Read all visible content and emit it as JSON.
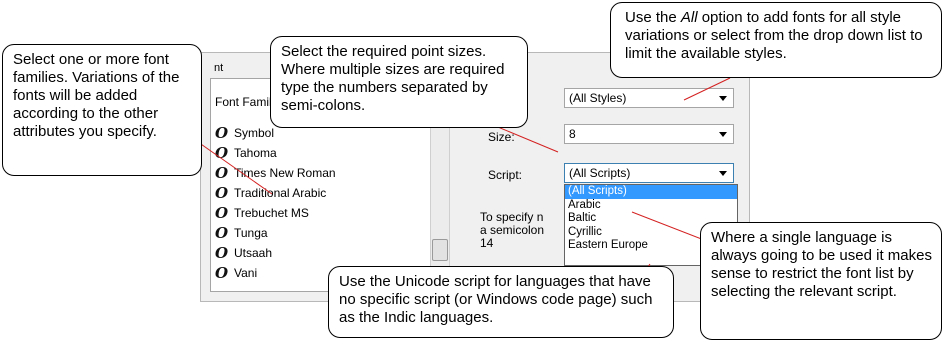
{
  "dialog": {
    "group_label": "nt",
    "list_header": "Font Famil",
    "fonts": [
      "Symbol",
      "Tahoma",
      "Times New Roman",
      "Traditional Arabic",
      "Trebuchet MS",
      "Tunga",
      "Utsaah",
      "Vani"
    ]
  },
  "style": {
    "value": "(All Styles)"
  },
  "size": {
    "label": "Size:",
    "value": "8"
  },
  "script": {
    "label": "Script:",
    "value": "(All Scripts)",
    "options": [
      "(All Scripts)",
      "Arabic",
      "Baltic",
      "Cyrillic",
      "Eastern Europe"
    ]
  },
  "hint": {
    "line1": "To specify n",
    "line2": "a semicolon",
    "line3": "14"
  },
  "callouts": {
    "families": "Select one or more font families. Variations of the fonts will be added according to the other attributes you specify.",
    "sizes": "Select the required point sizes. Where multiple sizes are required type the numbers separated by semi-colons.",
    "styles_pre": "Use the ",
    "styles_em": "All",
    "styles_post": " option to add fonts for all style variations or select from the drop down list to limit the available styles.",
    "unicode": "Use the Unicode script for languages that have no specific script (or Windows code page) such as the Indic languages.",
    "language": "Where a single language is always going to be used it makes sense to restrict the font list by selecting the relevant script."
  }
}
